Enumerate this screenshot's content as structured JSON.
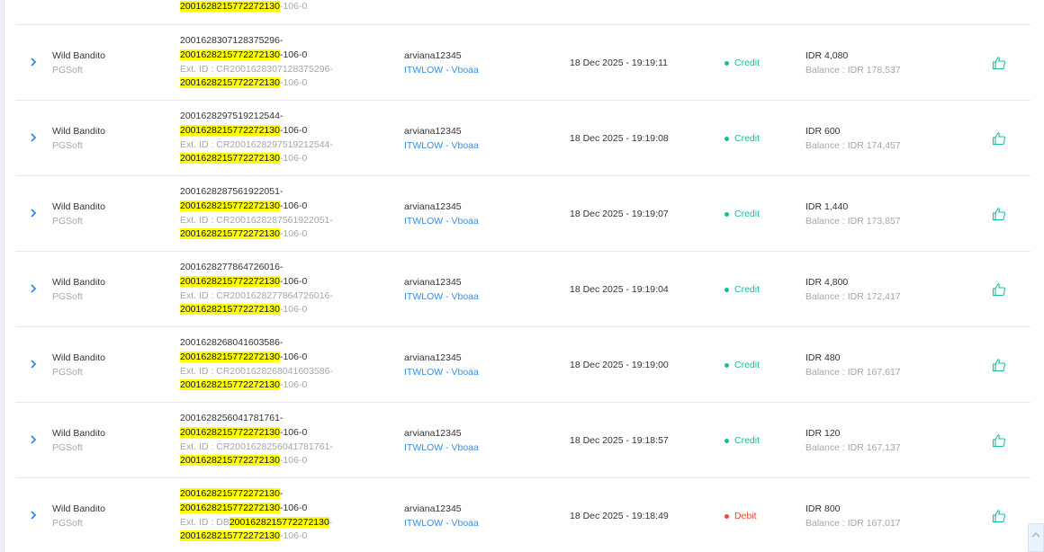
{
  "colors": {
    "highlight": "#ffff00",
    "credit": "#1abc9c",
    "debit": "#e74c3c",
    "link": "#3a8ee6",
    "thumb": "#1abc9c"
  },
  "icons": {
    "expand": "chevron-right-icon",
    "action": "thumbs-up-icon",
    "scroll": "chevron-up-icon"
  },
  "partial_row": {
    "ext_id_hl": "2001628215772272130",
    "ext_id_suffix": "-106-0"
  },
  "rows": [
    {
      "game": "Wild Bandito",
      "provider": "PGSoft",
      "tx_prefix": "2001628307128375296-",
      "tx_hl": "2001628215772272130",
      "tx_suffix": "-106-0",
      "ext_label": "Ext. ID : CR2001628307128375296-",
      "ext_hl": "",
      "ext_tail": "",
      "ext2_hl": "2001628215772272130",
      "ext2_suffix": "-106-0",
      "username": "arviana12345",
      "agent": "ITWLOW - Vboaa",
      "date": "18 Dec 2025 - 19:19:11",
      "type": "Credit",
      "amount": "IDR 4,080",
      "balance": "Balance : IDR 178,537"
    },
    {
      "game": "Wild Bandito",
      "provider": "PGSoft",
      "tx_prefix": "2001628297519212544-",
      "tx_hl": "2001628215772272130",
      "tx_suffix": "-106-0",
      "ext_label": "Ext. ID : CR2001628297519212544-",
      "ext_hl": "",
      "ext_tail": "",
      "ext2_hl": "2001628215772272130",
      "ext2_suffix": "-106-0",
      "username": "arviana12345",
      "agent": "ITWLOW - Vboaa",
      "date": "18 Dec 2025 - 19:19:08",
      "type": "Credit",
      "amount": "IDR 600",
      "balance": "Balance : IDR 174,457"
    },
    {
      "game": "Wild Bandito",
      "provider": "PGSoft",
      "tx_prefix": "2001628287561922051-",
      "tx_hl": "2001628215772272130",
      "tx_suffix": "-106-0",
      "ext_label": "Ext. ID : CR2001628287561922051-",
      "ext_hl": "",
      "ext_tail": "",
      "ext2_hl": "2001628215772272130",
      "ext2_suffix": "-106-0",
      "username": "arviana12345",
      "agent": "ITWLOW - Vboaa",
      "date": "18 Dec 2025 - 19:19:07",
      "type": "Credit",
      "amount": "IDR 1,440",
      "balance": "Balance : IDR 173,857"
    },
    {
      "game": "Wild Bandito",
      "provider": "PGSoft",
      "tx_prefix": "2001628277864726016-",
      "tx_hl": "2001628215772272130",
      "tx_suffix": "-106-0",
      "ext_label": "Ext. ID : CR2001628277864726016-",
      "ext_hl": "",
      "ext_tail": "",
      "ext2_hl": "2001628215772272130",
      "ext2_suffix": "-106-0",
      "username": "arviana12345",
      "agent": "ITWLOW - Vboaa",
      "date": "18 Dec 2025 - 19:19:04",
      "type": "Credit",
      "amount": "IDR 4,800",
      "balance": "Balance : IDR 172,417"
    },
    {
      "game": "Wild Bandito",
      "provider": "PGSoft",
      "tx_prefix": "2001628268041603586-",
      "tx_hl": "2001628215772272130",
      "tx_suffix": "-106-0",
      "ext_label": "Ext. ID : CR2001628268041603586-",
      "ext_hl": "",
      "ext_tail": "",
      "ext2_hl": "2001628215772272130",
      "ext2_suffix": "-106-0",
      "username": "arviana12345",
      "agent": "ITWLOW - Vboaa",
      "date": "18 Dec 2025 - 19:19:00",
      "type": "Credit",
      "amount": "IDR 480",
      "balance": "Balance : IDR 167,617"
    },
    {
      "game": "Wild Bandito",
      "provider": "PGSoft",
      "tx_prefix": "2001628256041781761-",
      "tx_hl": "2001628215772272130",
      "tx_suffix": "-106-0",
      "ext_label": "Ext. ID : CR2001628256041781761-",
      "ext_hl": "",
      "ext_tail": "",
      "ext2_hl": "2001628215772272130",
      "ext2_suffix": "-106-0",
      "username": "arviana12345",
      "agent": "ITWLOW - Vboaa",
      "date": "18 Dec 2025 - 19:18:57",
      "type": "Credit",
      "amount": "IDR 120",
      "balance": "Balance : IDR 167,137"
    },
    {
      "game": "Wild Bandito",
      "provider": "PGSoft",
      "tx_prefix": "",
      "tx_prefix_hl": "2001628215772272130",
      "tx_prefix_dash": "-",
      "tx_hl": "2001628215772272130",
      "tx_suffix": "-106-0",
      "ext_label": "Ext. ID : DB",
      "ext_hl": "2001628215772272130",
      "ext_tail": "-",
      "ext2_hl": "2001628215772272130",
      "ext2_suffix": "-106-0",
      "username": "arviana12345",
      "agent": "ITWLOW - Vboaa",
      "date": "18 Dec 2025 - 19:18:49",
      "type": "Debit",
      "amount": "IDR 800",
      "balance": "Balance : IDR 167,017"
    }
  ]
}
